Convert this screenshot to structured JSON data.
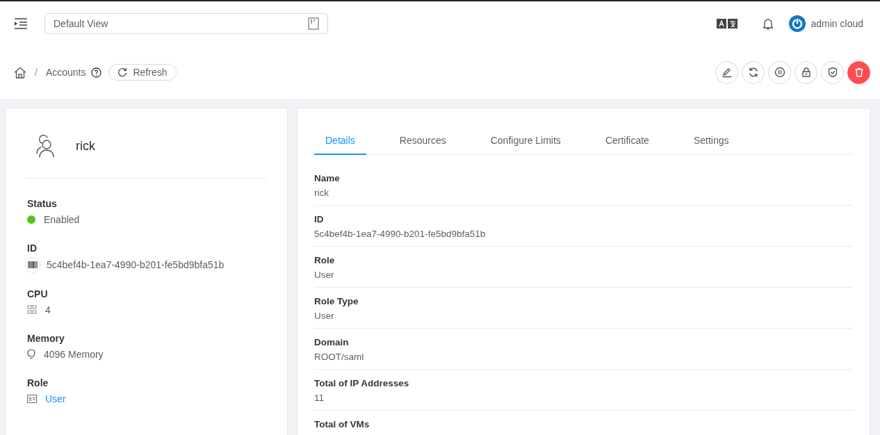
{
  "header": {
    "view_select": "Default View",
    "user_name": "admin cloud"
  },
  "breadcrumb": {
    "separator": "/",
    "items": [
      "Accounts"
    ],
    "refresh": "Refresh"
  },
  "actions": [
    {
      "kind": "edit",
      "danger": false
    },
    {
      "kind": "sync",
      "danger": false
    },
    {
      "kind": "pause",
      "danger": false
    },
    {
      "kind": "lock",
      "danger": false
    },
    {
      "kind": "shield",
      "danger": false
    },
    {
      "kind": "delete",
      "danger": true
    }
  ],
  "profile": {
    "name": "rick",
    "fields": [
      {
        "label": "Status",
        "kind": "status",
        "value": "Enabled",
        "color": "#52c41a"
      },
      {
        "label": "ID",
        "kind": "barcode",
        "value": "5c4bef4b-1ea7-4990-b201-fe5bd9bfa51b"
      },
      {
        "label": "CPU",
        "kind": "cpu",
        "value": "4"
      },
      {
        "label": "Memory",
        "kind": "memory",
        "value": "4096 Memory"
      },
      {
        "label": "Role",
        "kind": "role",
        "value": "User",
        "link": true
      }
    ]
  },
  "tabs": [
    {
      "label": "Details",
      "selected": true
    },
    {
      "label": "Resources",
      "selected": false
    },
    {
      "label": "Configure Limits",
      "selected": false
    },
    {
      "label": "Certificate",
      "selected": false
    },
    {
      "label": "Settings",
      "selected": false
    }
  ],
  "details": [
    {
      "label": "Name",
      "value": "rick"
    },
    {
      "label": "ID",
      "value": "5c4bef4b-1ea7-4990-b201-fe5bd9bfa51b"
    },
    {
      "label": "Role",
      "value": "User"
    },
    {
      "label": "Role Type",
      "value": "User"
    },
    {
      "label": "Domain",
      "value": "ROOT/saml"
    },
    {
      "label": "Total of IP Addresses",
      "value": "11"
    },
    {
      "label": "Total of VMs"
    }
  ]
}
